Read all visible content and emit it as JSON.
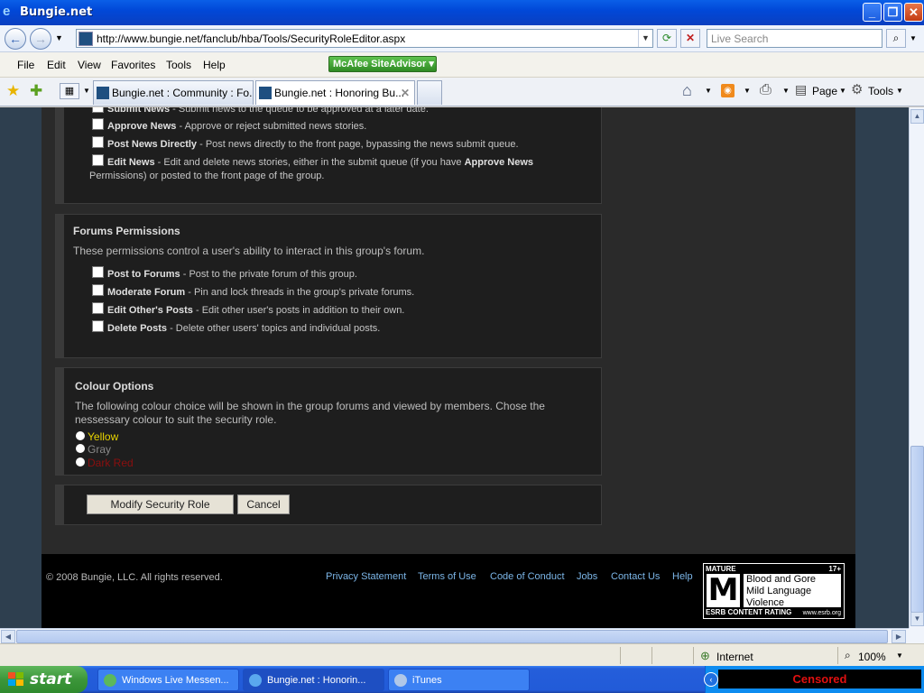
{
  "window": {
    "title": "Bungie.net",
    "min_icon": "minimize-icon",
    "max_icon": "restore-icon",
    "close_icon": "close-icon"
  },
  "address": {
    "url": "http://www.bungie.net/fanclub/hba/Tools/SecurityRoleEditor.aspx",
    "search_placeholder": "Live Search"
  },
  "menu": [
    "File",
    "Edit",
    "View",
    "Favorites",
    "Tools",
    "Help"
  ],
  "addon": {
    "label": "McAfee SiteAdvisor"
  },
  "tabs": [
    {
      "label": "Bungie.net : Community : Fo..."
    },
    {
      "label": "Bungie.net : Honoring Bu..."
    }
  ],
  "commands": {
    "page": "Page",
    "tools": "Tools"
  },
  "news_panel": {
    "partial_item": {
      "name": "Submit News",
      "desc": " - Submit news to the queue to be approved at a later date."
    },
    "items": [
      {
        "name": "Approve News",
        "desc": " - Approve or reject submitted news stories."
      },
      {
        "name": "Post News Directly",
        "desc": " - Post news directly to the front page, bypassing the news submit queue."
      },
      {
        "name": "Edit News",
        "desc": " - Edit and delete news stories, either in the submit queue (if you have ",
        "desc_bold": "Approve News",
        "desc_cont": "Permissions) or posted to the front page of the group."
      }
    ]
  },
  "forums_panel": {
    "title": "Forums Permissions",
    "description": "These permissions control a user's ability to interact in this group's forum.",
    "items": [
      {
        "name": "Post to Forums",
        "desc": " - Post to the private forum of this group."
      },
      {
        "name": "Moderate Forum",
        "desc": " - Pin and lock threads in the group's private forums."
      },
      {
        "name": "Edit Other's Posts",
        "desc": " - Edit other user's posts in addition to their own."
      },
      {
        "name": "Delete Posts",
        "desc": " - Delete other users' topics and individual posts."
      }
    ]
  },
  "colour_panel": {
    "title": "Colour Options",
    "description_line1": "The following colour choice will be shown in the group forums and viewed by members. Chose the",
    "description_line2": "nessessary colour to suit the security role.",
    "options": [
      {
        "label": "Yellow",
        "color": "#e8d400"
      },
      {
        "label": "Gray",
        "color": "#8a8a8a"
      },
      {
        "label": "Dark Red",
        "color": "#8b0f0f"
      }
    ]
  },
  "actions": {
    "modify": "Modify Security Role",
    "cancel": "Cancel"
  },
  "footer": {
    "copyright": "© 2008 Bungie, LLC. All rights reserved.",
    "links": [
      "Privacy Statement",
      "Terms of Use",
      "Code of Conduct",
      "Jobs",
      "Contact Us",
      "Help"
    ],
    "esrb": {
      "rating_label": "MATURE",
      "age": "17+",
      "letter": "M",
      "descriptors": [
        "Blood and Gore",
        "Mild Language",
        "Violence"
      ],
      "content_rating": "ESRB CONTENT RATING",
      "site": "www.esrb.org"
    }
  },
  "status": {
    "zone": "Internet",
    "zoom": "100%"
  },
  "taskbar": {
    "start": "start",
    "tasks": [
      {
        "label": "Windows Live Messen..."
      },
      {
        "label": "Bungie.net : Honorin..."
      },
      {
        "label": "iTunes"
      }
    ],
    "tray_text": "Censored"
  }
}
